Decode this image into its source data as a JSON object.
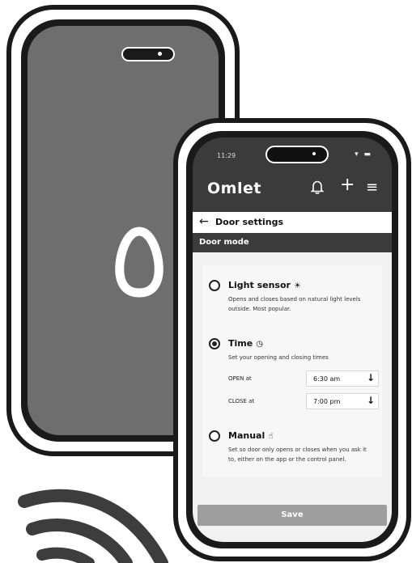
{
  "status": {
    "time": "11:29",
    "icons": "▾ ▬"
  },
  "app": {
    "brand": "Omlet"
  },
  "header_icons": {
    "bell": "bell-icon",
    "plus": "+",
    "menu": "≡"
  },
  "door_settings": {
    "back_icon": "←",
    "title": "Door settings"
  },
  "section": {
    "title": "Door mode"
  },
  "options": [
    {
      "title": "Light sensor",
      "icon": "☀",
      "description": "Opens and closes based on natural light levels outside. Most popular.",
      "selected": false
    },
    {
      "title": "Time",
      "icon": "◷",
      "description": "Set your opening and closing times",
      "selected": true,
      "times": [
        {
          "label": "OPEN at",
          "value": "6:30 am"
        },
        {
          "label": "CLOSE at",
          "value": "7:00 pm"
        }
      ]
    },
    {
      "title": "Manual",
      "icon": "☝",
      "description": "Set so door only opens or closes when you ask it to, either on the app or the control panel.",
      "selected": false
    }
  ],
  "dropdown_icon": "↓",
  "save_label": "Save"
}
